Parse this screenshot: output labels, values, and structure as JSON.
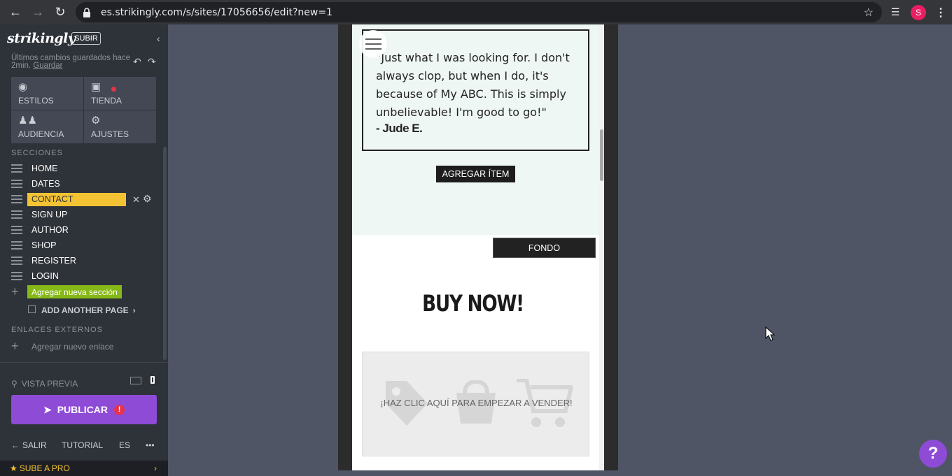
{
  "browser": {
    "url": "es.strikingly.com/s/sites/17056656/edit?new=1",
    "avatar_letter": "S",
    "avatar_color": "#e91e63"
  },
  "sidebar": {
    "logo": "strikingly",
    "upgrade_badge": "SUBIR",
    "saved_text": "Últimos cambios guardados hace 2min.",
    "save_link": "Guardar",
    "tiles": [
      {
        "label": "ESTILOS",
        "icon": "palette-icon"
      },
      {
        "label": "TIENDA",
        "icon": "shopping-bag-icon"
      },
      {
        "label": "AUDIENCIA",
        "icon": "people-icon"
      },
      {
        "label": "AJUSTES",
        "icon": "gear-icon"
      }
    ],
    "sections_header": "SECCIONES",
    "sections": [
      "HOME",
      "DATES",
      "CONTACT",
      "SIGN UP",
      "AUTHOR",
      "SHOP",
      "REGISTER",
      "LOGIN"
    ],
    "active_section": "CONTACT",
    "add_section": "Agregar nueva sección",
    "add_page": "ADD ANOTHER PAGE",
    "external_links_header": "ENLACES EXTERNOS",
    "add_link": "Agregar nuevo enlace",
    "preview": "VISTA PREVIA",
    "publish": "PUBLICAR",
    "publish_alert": "!",
    "bottom": {
      "exit": "SALIR",
      "tutorial": "TUTORIAL",
      "lang": "ES",
      "more": "•••"
    },
    "upgrade": "SUBE A PRO",
    "accent_active": "#f4c333",
    "accent_add": "#86b817",
    "accent_publish": "#8e4bd6"
  },
  "canvas": {
    "testimonial_quote": "\"Just what I was looking for. I don't always clop, but when I do, it's because of My ABC. This is simply unbelievable! I'm good to go!\"",
    "testimonial_author": "- Jude E.",
    "add_item": "AGREGAR ÍTEM",
    "background_button": "FONDO",
    "buy_heading": "BUY NOW!",
    "shop_cta": "¡HAZ CLIC AQUÍ PARA EMPEZAR A VENDER!"
  },
  "help": "?"
}
